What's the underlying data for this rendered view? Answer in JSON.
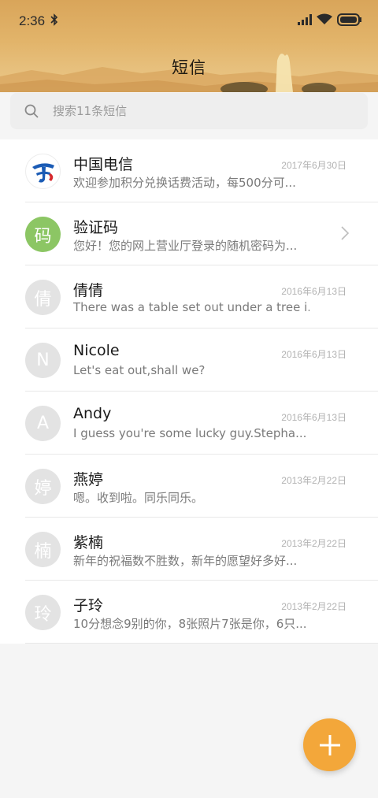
{
  "status_bar": {
    "time": "2:36"
  },
  "header": {
    "title": "短信"
  },
  "search": {
    "placeholder": "搜索11条短信"
  },
  "conversations": [
    {
      "avatar_text": "",
      "avatar_type": "telecom-logo",
      "name": "中国电信",
      "snippet": "欢迎参加积分兑换话费活动，每500分可...",
      "date": "2017年6月30日"
    },
    {
      "avatar_text": "码",
      "avatar_type": "green",
      "name": "验证码",
      "snippet": "您好！您的网上营业厅登录的随机密码为...",
      "date": ""
    },
    {
      "avatar_text": "倩",
      "avatar_type": "gray",
      "name": "倩倩",
      "snippet": "There was a table set out under a tree i...",
      "date": "2016年6月13日"
    },
    {
      "avatar_text": "N",
      "avatar_type": "gray",
      "name": "Nicole",
      "snippet": "Let's eat out,shall we?",
      "date": "2016年6月13日"
    },
    {
      "avatar_text": "A",
      "avatar_type": "gray",
      "name": "Andy",
      "snippet": "I guess you're some lucky guy.Stepha...",
      "date": "2016年6月13日"
    },
    {
      "avatar_text": "婷",
      "avatar_type": "gray",
      "name": "燕婷",
      "snippet": "嗯。收到啦。同乐同乐。",
      "date": "2013年2月22日"
    },
    {
      "avatar_text": "楠",
      "avatar_type": "gray",
      "name": "紫楠",
      "snippet": "新年的祝福数不胜数，新年的愿望好多好...",
      "date": "2013年2月22日"
    },
    {
      "avatar_text": "玲",
      "avatar_type": "gray",
      "name": "子玲",
      "snippet": "10分想念9别的你，8张照片7张是你，6只...",
      "date": "2013年2月22日"
    }
  ],
  "colors": {
    "accent": "#f3a73a",
    "avatar_green": "#8cc664",
    "avatar_gray": "#e3e3e3"
  },
  "fab": {
    "icon": "plus-icon"
  }
}
